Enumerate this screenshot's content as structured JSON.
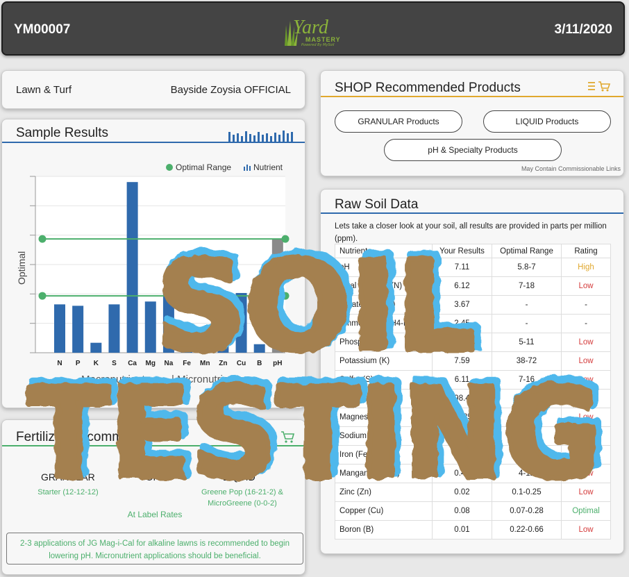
{
  "header": {
    "id": "YM00007",
    "date": "3/11/2020",
    "logo_yard": "Yard",
    "logo_mastery": "MASTERY",
    "logo_tagline": "Powered By MySoil"
  },
  "lawn": {
    "type": "Lawn & Turf",
    "grass": "Bayside Zoysia OFFICIAL"
  },
  "sample": {
    "title": "Sample Results",
    "legend_optimal": "Optimal Range",
    "legend_nutrient": "Nutrient",
    "y_label": "Optimal",
    "group_left": "Macronutrients",
    "group_right": "Micronutrients",
    "link_partial": "Le"
  },
  "chart_data": {
    "type": "bar",
    "categories": [
      "N",
      "P",
      "K",
      "S",
      "Ca",
      "Mg",
      "Na",
      "Fe",
      "Mn",
      "Zn",
      "Cu",
      "B",
      "pH"
    ],
    "values": [
      1.7,
      1.65,
      0.35,
      1.7,
      6.0,
      1.8,
      2.2,
      0.5,
      0.3,
      0.4,
      2.1,
      0.3,
      4.0
    ],
    "optimal_range": [
      2,
      4
    ],
    "ylim": [
      0,
      6.2
    ],
    "colors": {
      "nutrient": "#2f6aad",
      "ph": "#8a8a8a",
      "optimal": "#4caf6c"
    }
  },
  "fert": {
    "title": "Fertilizer Recommendation",
    "granular": "GRANULAR",
    "or": "-OR-",
    "liquid": "LIQUID",
    "granular_product": "Starter (12-12-12)",
    "liquid_product_1": "Greene Pop (16-21-2) &",
    "liquid_product_2": "MicroGreene (0-0-2)",
    "rate": "At Label Rates",
    "note_1": "2-3 applications of JG Mag-i-Cal for alkaline lawns is recommended to begin",
    "note_2": "lowering pH. Micronutrient applications should be beneficial."
  },
  "shop": {
    "title": "SHOP Recommended Products",
    "btn_granular": "GRANULAR Products",
    "btn_liquid": "LIQUID Products",
    "btn_ph": "pH & Specialty Products",
    "disclaimer": "May Contain Commissionable Links"
  },
  "raw": {
    "title": "Raw Soil Data",
    "intro": "Lets take a closer look at your soil, all results are provided in parts per million (ppm).",
    "headers": [
      "Nutrient",
      "Your Results",
      "Optimal Range",
      "Rating"
    ],
    "rows": [
      [
        "pH",
        "7.11",
        "5.8-7",
        "High"
      ],
      [
        "Total Nitrogen (N)",
        "6.12",
        "7-18",
        "Low"
      ],
      [
        "Nitrate (NO3-N)",
        "3.67",
        "-",
        "-"
      ],
      [
        "Ammonium (NH4-N)",
        "2.45",
        "-",
        "-"
      ],
      [
        "Phosphorus (P)",
        "",
        "5-11",
        "Low"
      ],
      [
        "Potassium (K)",
        "7.59",
        "38-72",
        "Low"
      ],
      [
        "Sulfur (S)",
        "6.11",
        "7-16",
        "Low"
      ],
      [
        "Calcium (Ca)",
        "898.44",
        "",
        "High"
      ],
      [
        "Magnesium (Mg)",
        "25.85",
        "-67",
        "Low"
      ],
      [
        "Sodium (Na)",
        "",
        "15-30",
        "Low"
      ],
      [
        "Iron (Fe)",
        "",
        "",
        "Low"
      ],
      [
        "Manganese (Mn)",
        "0.46",
        "4-12",
        "Low"
      ],
      [
        "Zinc (Zn)",
        "0.02",
        "0.1-0.25",
        "Low"
      ],
      [
        "Copper (Cu)",
        "0.08",
        "0.07-0.28",
        "Optimal"
      ],
      [
        "Boron (B)",
        "0.01",
        "0.22-0.66",
        "Low"
      ]
    ]
  },
  "overlay": {
    "line1": "SOIL",
    "line2": "TESTING"
  }
}
